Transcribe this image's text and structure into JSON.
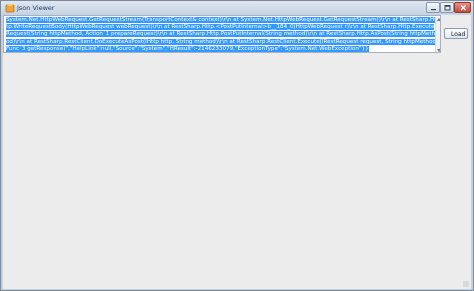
{
  "window": {
    "title": "Json Viewer"
  },
  "textbox": {
    "value": "System.Net.HttpWebRequest.GetRequestStream(TransportContext& context)\\r\\n   at System.Net.HttpWebRequest.GetRequestStream()\\r\\n   at RestSharp.Http.WriteRequestBody(HttpWebRequest webRequest)\\r\\n   at RestSharp.Http.<PostPutInternal>b__184_0(HttpWebRequest r)\\r\\n   at RestSharp.Http.ExecuteRequest(String httpMethod, Action`1 prepareRequest)\\r\\n   at RestSharp.Http.PostPutInternal(String method)\\r\\n   at RestSharp.Http.AsPost(String httpMethod)\\r\\n   at RestSharp.RestClient.DoExecuteAsPost(IHttp http, String method)\\r\\n   at RestSharp.RestClient.Execute(IRestRequest request, String httpMethod, Func`3 getResponse)\",\"HelpLink\":null,\"Source\":\"System\",\"HResult\":-2146233079,\"ExceptionType\":\"System.Net.WebException\"}}"
  },
  "buttons": {
    "load": "Load"
  },
  "colors": {
    "selection": "#3399ff",
    "titlebar": "#c5d2e3",
    "client": "#ececec"
  }
}
